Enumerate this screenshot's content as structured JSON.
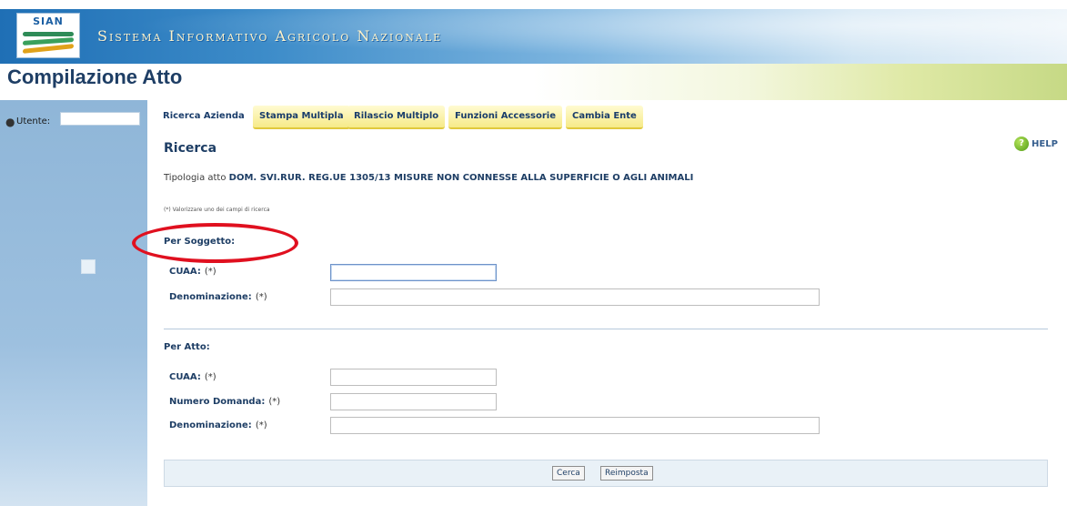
{
  "header": {
    "logo_text": "SIAN",
    "system_name": "Sistema Informativo Agricolo Nazionale",
    "page_title": "Compilazione Atto"
  },
  "sidebar": {
    "user_label": "Utente:",
    "user_value": ""
  },
  "tabs": [
    {
      "label": "Ricerca Azienda",
      "selected": true
    },
    {
      "label": "Stampa Multipla",
      "selected": false
    },
    {
      "label": "Rilascio Multiplo",
      "selected": false
    },
    {
      "label": "Funzioni Accessorie",
      "selected": false
    },
    {
      "label": "Cambia Ente",
      "selected": false
    }
  ],
  "help": {
    "label": "HELP",
    "icon": "help-icon",
    "icon_glyph": "?"
  },
  "main": {
    "section_title": "Ricerca",
    "tipologia_label": "Tipologia atto",
    "tipologia_value": "DOM. SVI.RUR. REG.UE 1305/13 MISURE NON CONNESSE ALLA SUPERFICIE O AGLI ANIMALI",
    "note": "(*) Valorizzare uno dei campi di ricerca",
    "per_soggetto": {
      "title": "Per Soggetto:",
      "fields": [
        {
          "label": "CUAA:",
          "req": "(*)",
          "value": ""
        },
        {
          "label": "Denominazione:",
          "req": "(*)",
          "value": ""
        }
      ]
    },
    "per_atto": {
      "title": "Per Atto:",
      "fields": [
        {
          "label": "CUAA:",
          "req": "(*)",
          "value": ""
        },
        {
          "label": "Numero Domanda:",
          "req": "(*)",
          "value": ""
        },
        {
          "label": "Denominazione:",
          "req": "(*)",
          "value": ""
        }
      ]
    },
    "buttons": {
      "search": "Cerca",
      "reset": "Reimposta"
    }
  },
  "colors": {
    "annotation_oval": "#e0101f",
    "accent": "#1e3e65"
  }
}
